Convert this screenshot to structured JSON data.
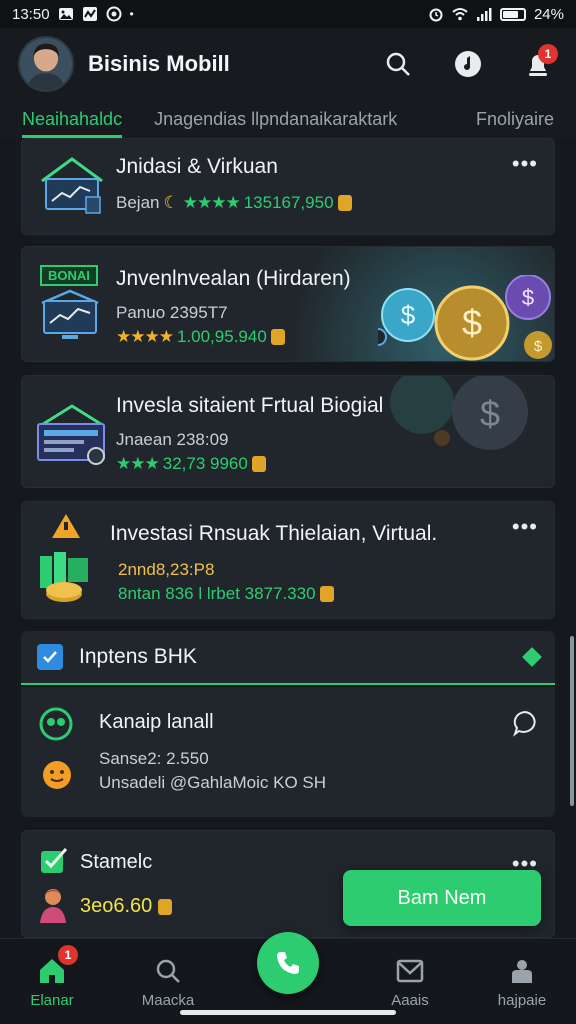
{
  "status_bar": {
    "time": "13:50",
    "battery": "24%",
    "icons": [
      "image-icon",
      "activity-icon",
      "whatsapp-icon",
      "alarm-icon",
      "wifi-icon",
      "signal-icon",
      "battery-icon"
    ]
  },
  "header": {
    "title": "Bisinis Mobill",
    "notification_count": "1"
  },
  "tabs": [
    {
      "label": "Neaihahaldc",
      "active": true
    },
    {
      "label": "Jnagendias llpndanaikaraktark",
      "active": false
    },
    {
      "label": "Fnoliyaire",
      "active": false
    }
  ],
  "cards": [
    {
      "title": "Jnidasi & Virkuan",
      "sub": "Bejan",
      "stars": "★★★★",
      "value": "135167,950"
    },
    {
      "tag": "BONAI",
      "title": "Jnvenlnvealan (Hirdaren)",
      "sub": "Panuo 2395T7",
      "stars": "★★★★",
      "value": "1.00,95.940"
    },
    {
      "title": "Invesla sitaient Frtual Biogial",
      "sub": "Jnaean 238:09",
      "stars": "★★★",
      "value": "32,73 9960"
    },
    {
      "title": "Investasi Rnsuak Thielaian, Virtual.",
      "sub": "2nnd8,23:P8",
      "meta": "8ntan 836 l lrbet 3877.330"
    }
  ],
  "section": {
    "title": "Inptens BHK",
    "item_title": "Kanaip lanall",
    "item_line1": "Sanse2: 2.550",
    "item_line2": "Unsadeli  @GahlaMoic KO SH"
  },
  "stats_card": {
    "title": "Stamelc",
    "value": "3eo6.60"
  },
  "fab": {
    "label": "Bam Nem"
  },
  "bottom_nav": {
    "items": [
      {
        "label": "Elanar",
        "icon": "home-icon",
        "badge": "1",
        "active": true
      },
      {
        "label": "Maacka",
        "icon": "search-icon",
        "active": false
      },
      {
        "label": "Aaais",
        "icon": "mail-icon",
        "active": false
      },
      {
        "label": "hajpaie",
        "icon": "profile-icon",
        "active": false
      }
    ]
  },
  "colors": {
    "accent": "#2ecc71",
    "background": "#15191d",
    "card": "#20262b",
    "badge": "#e0342e",
    "gold": "#f0c14b"
  }
}
